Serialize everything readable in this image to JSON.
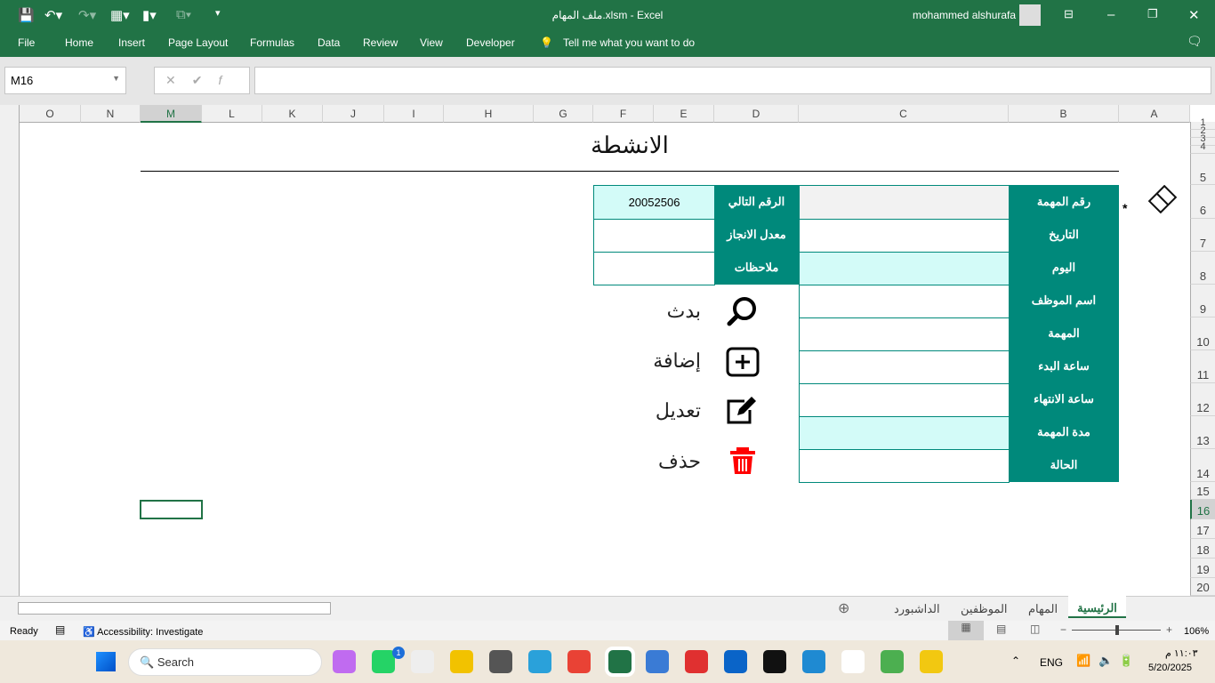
{
  "window": {
    "title": "ملف المهام.xlsm  -  Excel",
    "user": "mohammed alshurafa"
  },
  "menu": [
    "File",
    "Home",
    "Insert",
    "Page Layout",
    "Formulas",
    "Data",
    "Review",
    "View",
    "Developer"
  ],
  "tell_me": "Tell me what you want to do",
  "name_box": "M16",
  "formula": "",
  "columns": [
    "O",
    "N",
    "M",
    "L",
    "K",
    "J",
    "I",
    "H",
    "G",
    "F",
    "E",
    "D",
    "C",
    "B",
    "A"
  ],
  "rows": [
    "1",
    "2",
    "3",
    "4",
    "5",
    "6",
    "7",
    "8",
    "9",
    "10",
    "11",
    "12",
    "13",
    "14",
    "15",
    "16",
    "17",
    "18",
    "19",
    "20"
  ],
  "sheet": {
    "title": "الانشطة",
    "form_labels": [
      "رقم المهمة",
      "التاريخ",
      "اليوم",
      "اسم الموظف",
      "المهمة",
      "ساعة البدء",
      "ساعة الانتهاء",
      "مدة المهمة",
      "الحالة"
    ],
    "side_labels": [
      "الرقم التالي",
      "معدل الانجاز",
      "ملاحظات"
    ],
    "next_number": "20052506",
    "marker": "*",
    "actions": {
      "search": "بدث",
      "add": "إضافة",
      "edit": "تعديل",
      "delete": "حذف"
    }
  },
  "tabs": [
    "الرئيسية",
    "المهام",
    "الموظفين",
    "الداشبورد"
  ],
  "status": {
    "ready": "Ready",
    "accessibility": "Accessibility: Investigate",
    "zoom": "106%"
  },
  "taskbar": {
    "search": "Search",
    "lang": "ENG",
    "time": "١١:٠٣ م",
    "date": "5/20/2025",
    "whatsapp_badge": "1"
  },
  "colors": {
    "excel_green": "#217346",
    "teal": "#00897b",
    "cyan": "#d3fbf8"
  }
}
